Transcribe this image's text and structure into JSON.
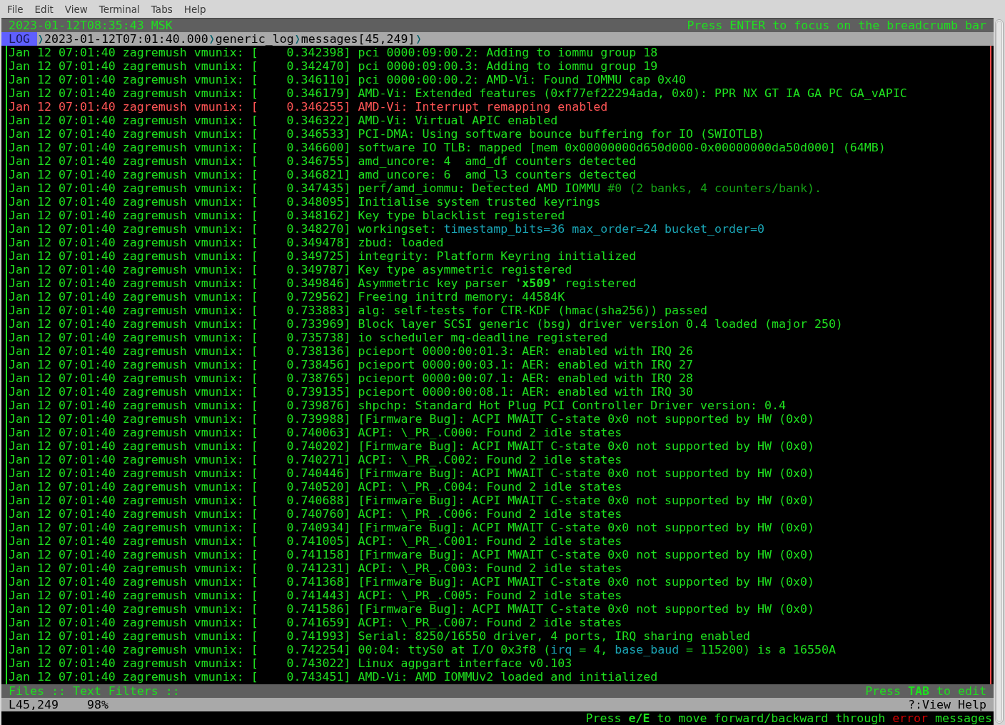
{
  "menu": [
    "File",
    "Edit",
    "View",
    "Terminal",
    "Tabs",
    "Help"
  ],
  "top_bar": {
    "clock": "2023-01-12T08:35:43 MSK",
    "hint": "Press ENTER to focus on the breadcrumb bar"
  },
  "breadcrumb": {
    "view": "LOG",
    "parts": [
      {
        "kind": "separator",
        "text": "❭"
      },
      {
        "kind": "crumb",
        "text": "2023-01-12T07:01:40.000"
      },
      {
        "kind": "separator",
        "text": "❭"
      },
      {
        "kind": "crumb",
        "text": "generic_log"
      },
      {
        "kind": "separator",
        "text": "❭"
      },
      {
        "kind": "crumb",
        "text": "messages[45,249]"
      },
      {
        "kind": "separator",
        "text": "❭"
      }
    ]
  },
  "log_lines": [
    {
      "error": false,
      "text": "Jan 12 07:01:40 zagremush vmunix: [    0.342398] pci 0000:09:00.2: Adding to iommu group 18"
    },
    {
      "error": false,
      "text": "Jan 12 07:01:40 zagremush vmunix: [    0.342470] pci 0000:09:00.3: Adding to iommu group 19"
    },
    {
      "error": false,
      "text": "Jan 12 07:01:40 zagremush vmunix: [    0.346110] pci 0000:00:00.2: AMD-Vi: Found IOMMU cap 0x40"
    },
    {
      "error": false,
      "text": "Jan 12 07:01:40 zagremush vmunix: [    0.346179] AMD-Vi: Extended features (0xf77ef22294ada, 0x0): PPR NX GT IA GA PC GA_vAPIC"
    },
    {
      "error": true,
      "text": "Jan 12 07:01:40 zagremush vmunix: [    0.346255] AMD-Vi: Interrupt remapping enabled"
    },
    {
      "error": false,
      "text": "Jan 12 07:01:40 zagremush vmunix: [    0.346322] AMD-Vi: Virtual APIC enabled"
    },
    {
      "error": false,
      "text": "Jan 12 07:01:40 zagremush vmunix: [    0.346533] PCI-DMA: Using software bounce buffering for IO (SWIOTLB)"
    },
    {
      "error": false,
      "text": "Jan 12 07:01:40 zagremush vmunix: [    0.346600] software IO TLB: mapped [mem 0x00000000d650d000-0x00000000da50d000] (64MB)"
    },
    {
      "error": false,
      "text": "Jan 12 07:01:40 zagremush vmunix: [    0.346755] amd_uncore: 4  amd_df counters detected"
    },
    {
      "error": false,
      "text": "Jan 12 07:01:40 zagremush vmunix: [    0.346821] amd_uncore: 6  amd_l3 counters detected"
    },
    {
      "error": false,
      "parts": [
        {
          "kind": "plain",
          "text": "Jan 12 07:01:40 zagremush vmunix: [    0.347435] perf/amd_iommu: Detected AMD IOMMU "
        },
        {
          "kind": "comment",
          "text": "#0 (2 banks, 4 counters/bank)."
        }
      ]
    },
    {
      "error": false,
      "text": "Jan 12 07:01:40 zagremush vmunix: [    0.348095] Initialise system trusted keyrings"
    },
    {
      "error": false,
      "text": "Jan 12 07:01:40 zagremush vmunix: [    0.348162] Key type blacklist registered"
    },
    {
      "error": false,
      "parts": [
        {
          "kind": "plain",
          "text": "Jan 12 07:01:40 zagremush vmunix: [    0.348270] workingset: "
        },
        {
          "kind": "variable",
          "text": "timestamp_bits=36 max_order=24 bucket_order=0"
        }
      ]
    },
    {
      "error": false,
      "text": "Jan 12 07:01:40 zagremush vmunix: [    0.349478] zbud: loaded"
    },
    {
      "error": false,
      "text": "Jan 12 07:01:40 zagremush vmunix: [    0.349725] integrity: Platform Keyring initialized"
    },
    {
      "error": false,
      "text": "Jan 12 07:01:40 zagremush vmunix: [    0.349787] Key type asymmetric registered"
    },
    {
      "error": false,
      "parts": [
        {
          "kind": "plain",
          "text": "Jan 12 07:01:40 zagremush vmunix: [    0.349846] Asymmetric key parser "
        },
        {
          "kind": "string",
          "text": "'x509'"
        },
        {
          "kind": "plain",
          "text": " registered"
        }
      ]
    },
    {
      "error": false,
      "text": "Jan 12 07:01:40 zagremush vmunix: [    0.729562] Freeing initrd memory: 44584K"
    },
    {
      "error": false,
      "text": "Jan 12 07:01:40 zagremush vmunix: [    0.733883] alg: self-tests for CTR-KDF (hmac(sha256)) passed"
    },
    {
      "error": false,
      "text": "Jan 12 07:01:40 zagremush vmunix: [    0.733969] Block layer SCSI generic (bsg) driver version 0.4 loaded (major 250)"
    },
    {
      "error": false,
      "text": "Jan 12 07:01:40 zagremush vmunix: [    0.735738] io scheduler mq-deadline registered"
    },
    {
      "error": false,
      "text": "Jan 12 07:01:40 zagremush vmunix: [    0.738136] pcieport 0000:00:01.3: AER: enabled with IRQ 26"
    },
    {
      "error": false,
      "text": "Jan 12 07:01:40 zagremush vmunix: [    0.738456] pcieport 0000:00:03.1: AER: enabled with IRQ 27"
    },
    {
      "error": false,
      "text": "Jan 12 07:01:40 zagremush vmunix: [    0.738765] pcieport 0000:00:07.1: AER: enabled with IRQ 28"
    },
    {
      "error": false,
      "text": "Jan 12 07:01:40 zagremush vmunix: [    0.739135] pcieport 0000:00:08.1: AER: enabled with IRQ 30"
    },
    {
      "error": false,
      "text": "Jan 12 07:01:40 zagremush vmunix: [    0.739876] shpchp: Standard Hot Plug PCI Controller Driver version: 0.4"
    },
    {
      "error": false,
      "text": "Jan 12 07:01:40 zagremush vmunix: [    0.739988] [Firmware Bug]: ACPI MWAIT C-state 0x0 not supported by HW (0x0)"
    },
    {
      "error": false,
      "text": "Jan 12 07:01:40 zagremush vmunix: [    0.740063] ACPI: \\_PR_.C000: Found 2 idle states"
    },
    {
      "error": false,
      "text": "Jan 12 07:01:40 zagremush vmunix: [    0.740202] [Firmware Bug]: ACPI MWAIT C-state 0x0 not supported by HW (0x0)"
    },
    {
      "error": false,
      "text": "Jan 12 07:01:40 zagremush vmunix: [    0.740271] ACPI: \\_PR_.C002: Found 2 idle states"
    },
    {
      "error": false,
      "text": "Jan 12 07:01:40 zagremush vmunix: [    0.740446] [Firmware Bug]: ACPI MWAIT C-state 0x0 not supported by HW (0x0)"
    },
    {
      "error": false,
      "text": "Jan 12 07:01:40 zagremush vmunix: [    0.740520] ACPI: \\_PR_.C004: Found 2 idle states"
    },
    {
      "error": false,
      "text": "Jan 12 07:01:40 zagremush vmunix: [    0.740688] [Firmware Bug]: ACPI MWAIT C-state 0x0 not supported by HW (0x0)"
    },
    {
      "error": false,
      "text": "Jan 12 07:01:40 zagremush vmunix: [    0.740760] ACPI: \\_PR_.C006: Found 2 idle states"
    },
    {
      "error": false,
      "text": "Jan 12 07:01:40 zagremush vmunix: [    0.740934] [Firmware Bug]: ACPI MWAIT C-state 0x0 not supported by HW (0x0)"
    },
    {
      "error": false,
      "text": "Jan 12 07:01:40 zagremush vmunix: [    0.741005] ACPI: \\_PR_.C001: Found 2 idle states"
    },
    {
      "error": false,
      "text": "Jan 12 07:01:40 zagremush vmunix: [    0.741158] [Firmware Bug]: ACPI MWAIT C-state 0x0 not supported by HW (0x0)"
    },
    {
      "error": false,
      "text": "Jan 12 07:01:40 zagremush vmunix: [    0.741231] ACPI: \\_PR_.C003: Found 2 idle states"
    },
    {
      "error": false,
      "text": "Jan 12 07:01:40 zagremush vmunix: [    0.741368] [Firmware Bug]: ACPI MWAIT C-state 0x0 not supported by HW (0x0)"
    },
    {
      "error": false,
      "text": "Jan 12 07:01:40 zagremush vmunix: [    0.741443] ACPI: \\_PR_.C005: Found 2 idle states"
    },
    {
      "error": false,
      "text": "Jan 12 07:01:40 zagremush vmunix: [    0.741586] [Firmware Bug]: ACPI MWAIT C-state 0x0 not supported by HW (0x0)"
    },
    {
      "error": false,
      "text": "Jan 12 07:01:40 zagremush vmunix: [    0.741659] ACPI: \\_PR_.C007: Found 2 idle states"
    },
    {
      "error": false,
      "text": "Jan 12 07:01:40 zagremush vmunix: [    0.741993] Serial: 8250/16550 driver, 4 ports, IRQ sharing enabled"
    },
    {
      "error": false,
      "parts": [
        {
          "kind": "plain",
          "text": "Jan 12 07:01:40 zagremush vmunix: [    0.742254] 00:04: ttyS0 at I/O 0x3f8 ("
        },
        {
          "kind": "variable",
          "text": "irq"
        },
        {
          "kind": "plain",
          "text": " = 4, "
        },
        {
          "kind": "variable",
          "text": "base_baud"
        },
        {
          "kind": "plain",
          "text": " = 115200) is a 16550A"
        }
      ]
    },
    {
      "error": false,
      "text": "Jan 12 07:01:40 zagremush vmunix: [    0.743022] Linux agpgart interface v0.103"
    },
    {
      "error": false,
      "text": "Jan 12 07:01:40 zagremush vmunix: [    0.743451] AMD-Vi: AMD IOMMUv2 loaded and initialized"
    }
  ],
  "panel_bar": {
    "tabs": "Files :: Text Filters ::",
    "hint": "Press **TAB** to edit"
  },
  "status_bar": {
    "position": "L45,249",
    "percent": "98%",
    "help": "?:View Help"
  },
  "message_line": [
    {
      "kind": "plain",
      "text": "Press "
    },
    {
      "kind": "key",
      "text": "e/E"
    },
    {
      "kind": "plain",
      "text": " to move forward/backward through "
    },
    {
      "kind": "error",
      "text": "error"
    },
    {
      "kind": "plain",
      "text": " messages"
    }
  ]
}
